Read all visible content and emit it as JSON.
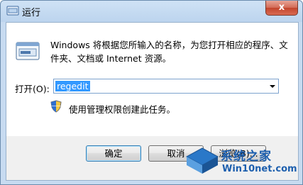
{
  "window": {
    "title": "运行",
    "close_label": "x"
  },
  "main": {
    "description": "Windows 将根据您所输入的名称，为您打开相应的程序、文件夹、文档或 Internet 资源。",
    "open_label": "打开(O):",
    "command_value": "regedit",
    "admin_note": "使用管理权限创建此任务。"
  },
  "buttons": {
    "ok": "确定",
    "cancel": "取消",
    "browse": "浏览(B)..."
  },
  "watermark": {
    "brand": "系统之家",
    "site": "Win10net.com"
  },
  "icons": {
    "app": "run-window-icon",
    "large": "run-program-icon",
    "shield": "uac-shield-icon",
    "dropdown": "chevron-down-icon"
  }
}
